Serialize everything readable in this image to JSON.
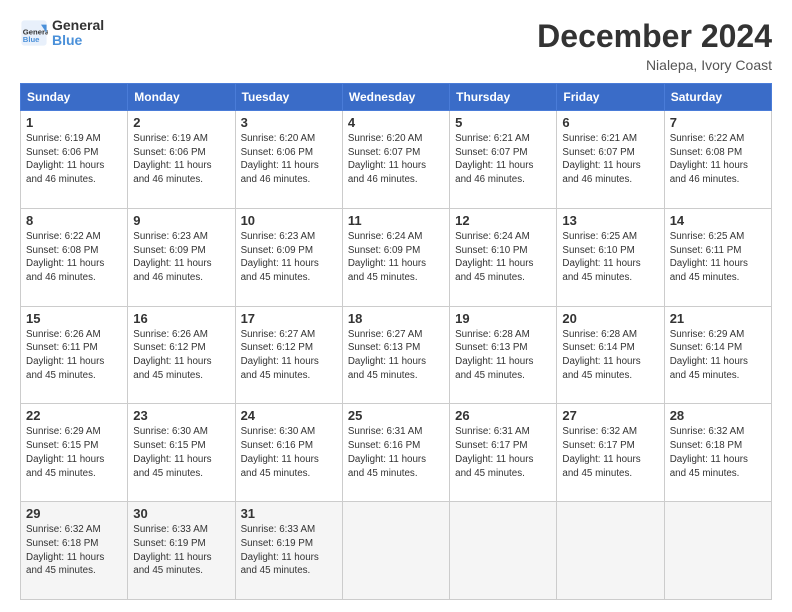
{
  "header": {
    "logo_general": "General",
    "logo_blue": "Blue",
    "title": "December 2024",
    "subtitle": "Nialepa, Ivory Coast"
  },
  "days_of_week": [
    "Sunday",
    "Monday",
    "Tuesday",
    "Wednesday",
    "Thursday",
    "Friday",
    "Saturday"
  ],
  "weeks": [
    [
      {
        "day": "1",
        "info": "Sunrise: 6:19 AM\nSunset: 6:06 PM\nDaylight: 11 hours\nand 46 minutes."
      },
      {
        "day": "2",
        "info": "Sunrise: 6:19 AM\nSunset: 6:06 PM\nDaylight: 11 hours\nand 46 minutes."
      },
      {
        "day": "3",
        "info": "Sunrise: 6:20 AM\nSunset: 6:06 PM\nDaylight: 11 hours\nand 46 minutes."
      },
      {
        "day": "4",
        "info": "Sunrise: 6:20 AM\nSunset: 6:07 PM\nDaylight: 11 hours\nand 46 minutes."
      },
      {
        "day": "5",
        "info": "Sunrise: 6:21 AM\nSunset: 6:07 PM\nDaylight: 11 hours\nand 46 minutes."
      },
      {
        "day": "6",
        "info": "Sunrise: 6:21 AM\nSunset: 6:07 PM\nDaylight: 11 hours\nand 46 minutes."
      },
      {
        "day": "7",
        "info": "Sunrise: 6:22 AM\nSunset: 6:08 PM\nDaylight: 11 hours\nand 46 minutes."
      }
    ],
    [
      {
        "day": "8",
        "info": "Sunrise: 6:22 AM\nSunset: 6:08 PM\nDaylight: 11 hours\nand 46 minutes."
      },
      {
        "day": "9",
        "info": "Sunrise: 6:23 AM\nSunset: 6:09 PM\nDaylight: 11 hours\nand 46 minutes."
      },
      {
        "day": "10",
        "info": "Sunrise: 6:23 AM\nSunset: 6:09 PM\nDaylight: 11 hours\nand 45 minutes."
      },
      {
        "day": "11",
        "info": "Sunrise: 6:24 AM\nSunset: 6:09 PM\nDaylight: 11 hours\nand 45 minutes."
      },
      {
        "day": "12",
        "info": "Sunrise: 6:24 AM\nSunset: 6:10 PM\nDaylight: 11 hours\nand 45 minutes."
      },
      {
        "day": "13",
        "info": "Sunrise: 6:25 AM\nSunset: 6:10 PM\nDaylight: 11 hours\nand 45 minutes."
      },
      {
        "day": "14",
        "info": "Sunrise: 6:25 AM\nSunset: 6:11 PM\nDaylight: 11 hours\nand 45 minutes."
      }
    ],
    [
      {
        "day": "15",
        "info": "Sunrise: 6:26 AM\nSunset: 6:11 PM\nDaylight: 11 hours\nand 45 minutes."
      },
      {
        "day": "16",
        "info": "Sunrise: 6:26 AM\nSunset: 6:12 PM\nDaylight: 11 hours\nand 45 minutes."
      },
      {
        "day": "17",
        "info": "Sunrise: 6:27 AM\nSunset: 6:12 PM\nDaylight: 11 hours\nand 45 minutes."
      },
      {
        "day": "18",
        "info": "Sunrise: 6:27 AM\nSunset: 6:13 PM\nDaylight: 11 hours\nand 45 minutes."
      },
      {
        "day": "19",
        "info": "Sunrise: 6:28 AM\nSunset: 6:13 PM\nDaylight: 11 hours\nand 45 minutes."
      },
      {
        "day": "20",
        "info": "Sunrise: 6:28 AM\nSunset: 6:14 PM\nDaylight: 11 hours\nand 45 minutes."
      },
      {
        "day": "21",
        "info": "Sunrise: 6:29 AM\nSunset: 6:14 PM\nDaylight: 11 hours\nand 45 minutes."
      }
    ],
    [
      {
        "day": "22",
        "info": "Sunrise: 6:29 AM\nSunset: 6:15 PM\nDaylight: 11 hours\nand 45 minutes."
      },
      {
        "day": "23",
        "info": "Sunrise: 6:30 AM\nSunset: 6:15 PM\nDaylight: 11 hours\nand 45 minutes."
      },
      {
        "day": "24",
        "info": "Sunrise: 6:30 AM\nSunset: 6:16 PM\nDaylight: 11 hours\nand 45 minutes."
      },
      {
        "day": "25",
        "info": "Sunrise: 6:31 AM\nSunset: 6:16 PM\nDaylight: 11 hours\nand 45 minutes."
      },
      {
        "day": "26",
        "info": "Sunrise: 6:31 AM\nSunset: 6:17 PM\nDaylight: 11 hours\nand 45 minutes."
      },
      {
        "day": "27",
        "info": "Sunrise: 6:32 AM\nSunset: 6:17 PM\nDaylight: 11 hours\nand 45 minutes."
      },
      {
        "day": "28",
        "info": "Sunrise: 6:32 AM\nSunset: 6:18 PM\nDaylight: 11 hours\nand 45 minutes."
      }
    ],
    [
      {
        "day": "29",
        "info": "Sunrise: 6:32 AM\nSunset: 6:18 PM\nDaylight: 11 hours\nand 45 minutes."
      },
      {
        "day": "30",
        "info": "Sunrise: 6:33 AM\nSunset: 6:19 PM\nDaylight: 11 hours\nand 45 minutes."
      },
      {
        "day": "31",
        "info": "Sunrise: 6:33 AM\nSunset: 6:19 PM\nDaylight: 11 hours\nand 45 minutes."
      },
      null,
      null,
      null,
      null
    ]
  ]
}
